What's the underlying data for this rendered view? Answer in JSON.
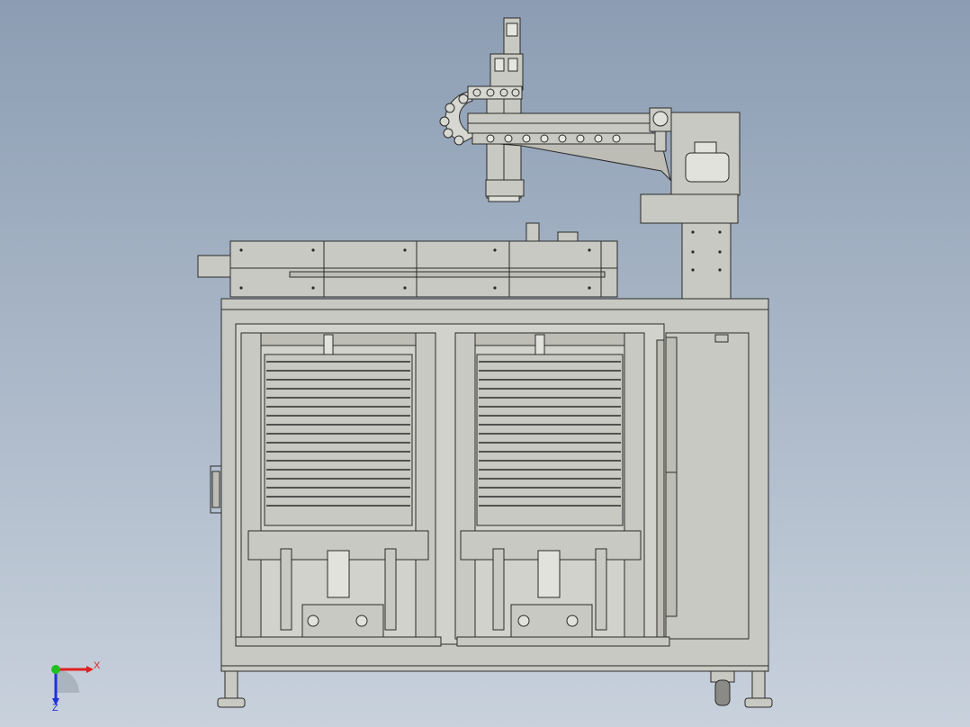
{
  "viewport": {
    "background_top": "#8c9db3",
    "background_bottom": "#c8d1dc",
    "model_fill": "#c9c9c3",
    "model_edge": "#2a2a2a",
    "shadow_fill": "#a8a8a2"
  },
  "triad": {
    "x_label": "X",
    "z_label": "Z",
    "x_color": "#e02020",
    "y_color": "#20c020",
    "z_color": "#2030e0"
  }
}
